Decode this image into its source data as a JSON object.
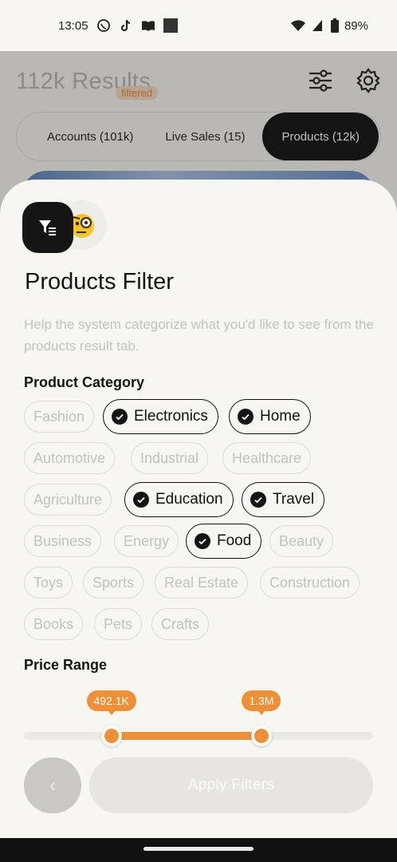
{
  "status_bar": {
    "time": "13:05",
    "battery": "89%",
    "icons": [
      "whatsapp-icon",
      "tiktok-icon",
      "book-icon",
      "square-icon",
      "wifi-icon",
      "signal-icon",
      "battery-icon"
    ]
  },
  "background": {
    "results_title": "112k Results",
    "filtered_badge": "filtered",
    "tabs": [
      {
        "label": "Accounts (101k)",
        "active": false
      },
      {
        "label": "Live Sales (15)",
        "active": false
      },
      {
        "label": "Products (12k)",
        "active": true
      }
    ],
    "icons": [
      "sliders-icon",
      "gear-icon"
    ]
  },
  "sheet": {
    "badge_icon": "filter-list-icon",
    "emoji_icon": "monocle-face-emoji",
    "title": "Products Filter",
    "description": "Help the system categorize what you'd like to see from the products result tab.",
    "category_label": "Product Category",
    "categories": [
      {
        "label": "Fashion",
        "selected": false
      },
      {
        "label": "Electronics",
        "selected": true
      },
      {
        "label": "Home",
        "selected": true
      },
      {
        "label": "Automotive",
        "selected": false
      },
      {
        "label": "Industrial",
        "selected": false
      },
      {
        "label": "Healthcare",
        "selected": false
      },
      {
        "label": "Agriculture",
        "selected": false
      },
      {
        "label": "Education",
        "selected": true
      },
      {
        "label": "Travel",
        "selected": true
      },
      {
        "label": "Business",
        "selected": false
      },
      {
        "label": "Energy",
        "selected": false
      },
      {
        "label": "Food",
        "selected": true
      },
      {
        "label": "Beauty",
        "selected": false
      },
      {
        "label": "Toys",
        "selected": false
      },
      {
        "label": "Sports",
        "selected": false
      },
      {
        "label": "Real Estate",
        "selected": false
      },
      {
        "label": "Construction",
        "selected": false
      },
      {
        "label": "Books",
        "selected": false
      },
      {
        "label": "Pets",
        "selected": false
      },
      {
        "label": "Crafts",
        "selected": false
      }
    ],
    "price_label": "Price Range",
    "price_min_label": "492.1K",
    "price_max_label": "1.3M",
    "price_min_fraction": 0.25,
    "price_max_fraction": 0.68,
    "back_label": "‹",
    "apply_label": "Apply  Filters"
  },
  "colors": {
    "accent": "#ef8f38",
    "dark": "#151515",
    "muted_text": "#c2c1bc",
    "sheet_bg": "#f7f6f2"
  }
}
